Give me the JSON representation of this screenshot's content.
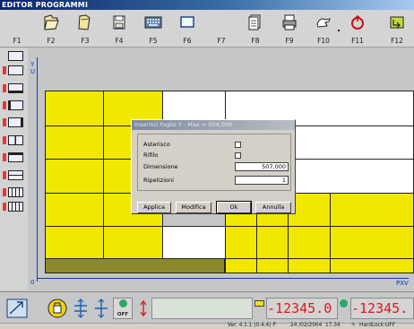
{
  "window": {
    "title": "EDITOR PROGRAMMI"
  },
  "toolbar": {
    "keys": [
      {
        "label": "F1",
        "icon": "none"
      },
      {
        "label": "F2",
        "icon": "folder-open-icon"
      },
      {
        "label": "F3",
        "icon": "folder-icon"
      },
      {
        "label": "F4",
        "icon": "save-disk-icon"
      },
      {
        "label": "F5",
        "icon": "keyboard-icon"
      },
      {
        "label": "F6",
        "icon": "rectangle-icon"
      },
      {
        "label": "F7",
        "icon": "none"
      },
      {
        "label": "F8",
        "icon": "document-stack-icon"
      },
      {
        "label": "F9",
        "icon": "printer-icon"
      },
      {
        "label": "F10",
        "icon": "hand-icon"
      },
      {
        "label": "F11",
        "icon": "undo-icon"
      },
      {
        "label": "F12",
        "icon": "exit-icon"
      }
    ]
  },
  "canvas": {
    "axis_y_label": "Y",
    "axis_u_label": "U",
    "axis_x_label": "PXV",
    "origin_label": "0"
  },
  "dialog": {
    "title": "Inserisci foglio Y - Max = 504,000",
    "fields": [
      {
        "label": "Asterisco",
        "type": "checkbox",
        "checked": false
      },
      {
        "label": "Rifilo",
        "type": "checkbox",
        "checked": false
      },
      {
        "label": "Dimensione",
        "type": "number",
        "value": "507,000"
      },
      {
        "label": "Ripetizioni",
        "type": "number",
        "value": "1"
      }
    ],
    "buttons": {
      "apply": "Applica",
      "edit": "Modifica",
      "ok": "Ok",
      "cancel": "Annulla"
    }
  },
  "bottombar": {
    "off_label": "OFF",
    "readout_1": "-12345.0",
    "readout_2": "-12345.",
    "colors": {
      "led": "#e0171e",
      "accent_green": "#2aa86b"
    }
  },
  "statusbar": {
    "version": "Ver. 4.1.1 (0.4.4) P",
    "date": "24 /02/2004",
    "time": "17.34",
    "lock": "HardLock:UFF"
  }
}
